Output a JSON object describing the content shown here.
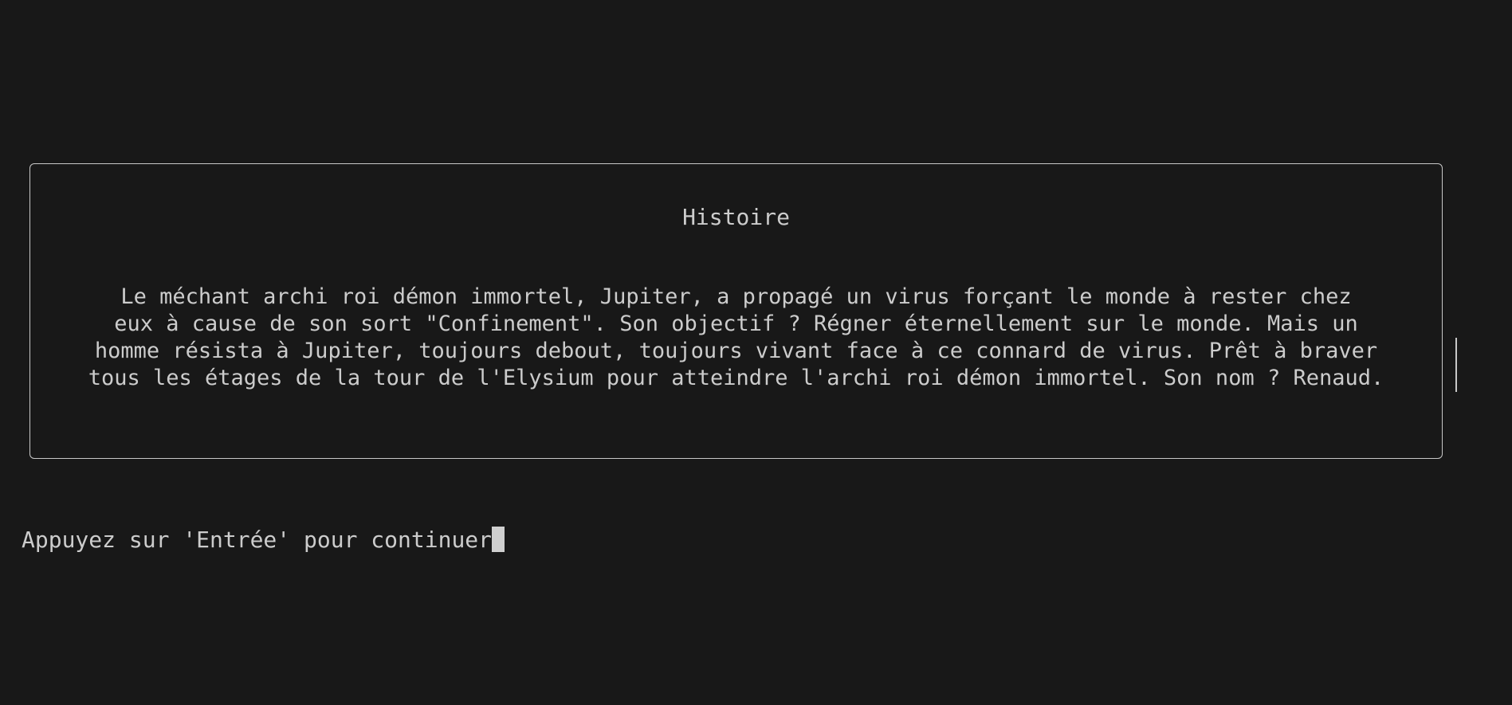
{
  "screen": {
    "title": "Histoire",
    "story_lines": [
      "Le méchant archi roi démon immortel, Jupiter, a propagé un virus forçant le monde à rester chez",
      "eux à cause de son sort \"Confinement\". Son objectif ? Régner éternellement sur le monde. Mais un",
      "homme résista à Jupiter, toujours debout, toujours vivant face à ce connard de virus. Prêt à braver",
      "tous les étages de la tour de l'Elysium pour atteindre l'archi roi démon immortel. Son nom ? Renaud."
    ],
    "prompt": "Appuyez sur 'Entrée' pour continuer"
  },
  "colors": {
    "background": "#181818",
    "text": "#cccccc",
    "border": "#c8c8c8",
    "cursor": "#cfcfcf"
  }
}
